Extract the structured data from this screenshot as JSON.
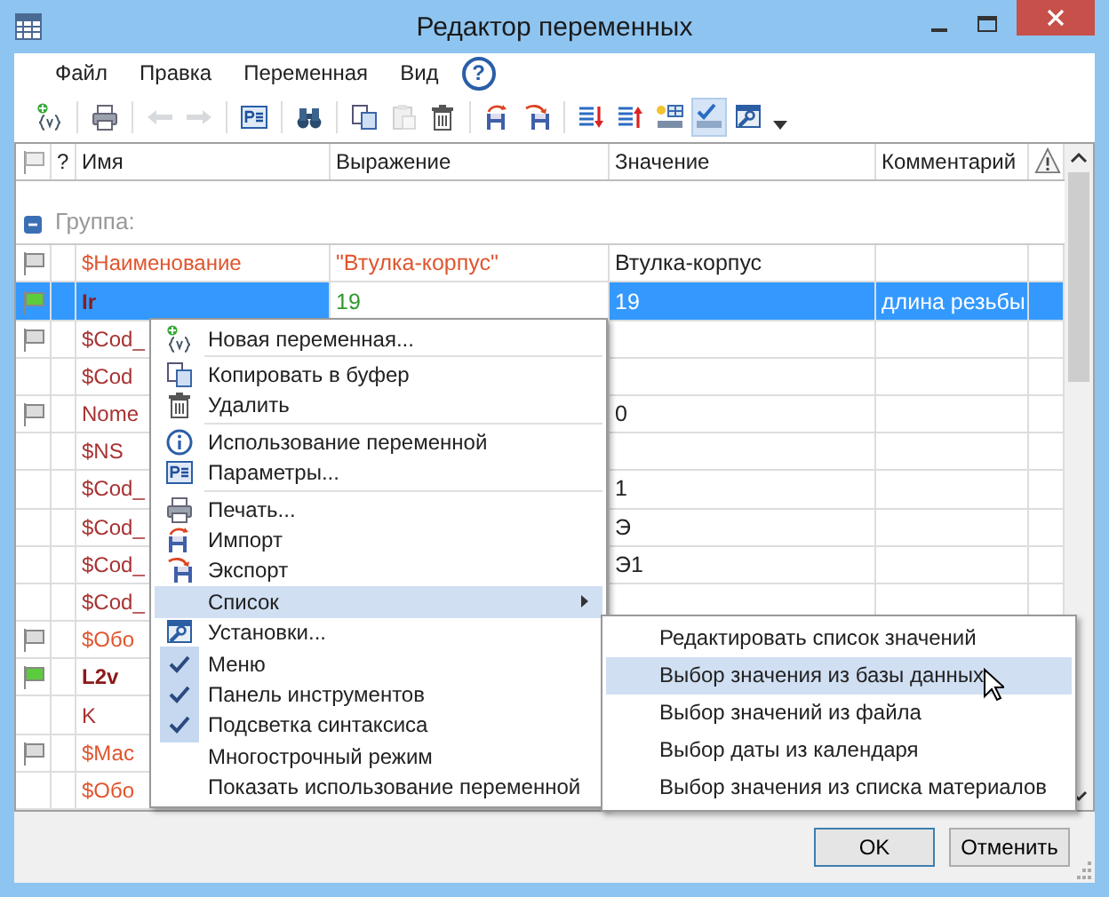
{
  "window": {
    "title": "Редактор переменных"
  },
  "menu": [
    {
      "label": "Файл"
    },
    {
      "label": "Правка"
    },
    {
      "label": "Переменная"
    },
    {
      "label": "Вид"
    }
  ],
  "help_button": {
    "label": "?"
  },
  "toolbar": [
    {
      "kind": "new",
      "disabled": false,
      "pressed": false
    },
    {
      "kind": "separator"
    },
    {
      "kind": "print",
      "disabled": false,
      "pressed": false
    },
    {
      "kind": "separator"
    },
    {
      "kind": "undo",
      "disabled": true,
      "pressed": false
    },
    {
      "kind": "redo",
      "disabled": true,
      "pressed": false
    },
    {
      "kind": "separator"
    },
    {
      "kind": "params",
      "disabled": false,
      "pressed": false
    },
    {
      "kind": "separator"
    },
    {
      "kind": "find",
      "disabled": false,
      "pressed": false
    },
    {
      "kind": "separator"
    },
    {
      "kind": "copy",
      "disabled": false,
      "pressed": false
    },
    {
      "kind": "paste",
      "disabled": true,
      "pressed": false
    },
    {
      "kind": "delete",
      "disabled": false,
      "pressed": false
    },
    {
      "kind": "separator"
    },
    {
      "kind": "import",
      "disabled": false,
      "pressed": false
    },
    {
      "kind": "export",
      "disabled": false,
      "pressed": false
    },
    {
      "kind": "separator"
    },
    {
      "kind": "sortdown",
      "disabled": false,
      "pressed": false
    },
    {
      "kind": "sortup",
      "disabled": false,
      "pressed": false
    },
    {
      "kind": "varnew",
      "disabled": false,
      "pressed": false
    },
    {
      "kind": "varcheck",
      "disabled": false,
      "pressed": true
    },
    {
      "kind": "settings",
      "disabled": false,
      "pressed": false
    }
  ],
  "table": {
    "columns": [
      "?",
      "Имя",
      "Выражение",
      "Значение",
      "Комментарий"
    ],
    "group": {
      "label": "Группа:",
      "expanded": true
    },
    "rows": [
      {
        "flag": {
          "color": "#dcdcdc"
        },
        "name": "$Наименование",
        "color": "#e0552e",
        "bold": false,
        "expression": {
          "text": "\"Втулка-корпус\"",
          "color": "#e0552e"
        },
        "value": "Втулка-корпус",
        "selected": false
      },
      {
        "flag": {
          "color": "#5ccc3c"
        },
        "name": "Ir",
        "color": "#8b1a1a",
        "bold": true,
        "expression": {
          "text": "19",
          "color": "#2f9a2f"
        },
        "value": "19",
        "comment": "длина резьбы",
        "selected": true
      },
      {
        "flag": {
          "color": "#dcdcdc"
        },
        "name": "$Cod_",
        "color": "#a83232",
        "bold": false,
        "selected": false
      },
      {
        "name": "$Cod",
        "color": "#a83232",
        "bold": false,
        "selected": false
      },
      {
        "flag": {
          "color": "#dcdcdc"
        },
        "name": "Nome",
        "color": "#a83232",
        "bold": false,
        "value": "0",
        "selected": false
      },
      {
        "name": "$NS",
        "color": "#a83232",
        "bold": false,
        "selected": false
      },
      {
        "name": "$Cod_",
        "color": "#a83232",
        "bold": false,
        "value": "1",
        "selected": false
      },
      {
        "name": "$Cod_",
        "color": "#a83232",
        "bold": false,
        "value": "Э",
        "selected": false
      },
      {
        "name": "$Cod_",
        "color": "#a83232",
        "bold": false,
        "value": "Э1",
        "selected": false
      },
      {
        "name": "$Cod_",
        "color": "#a83232",
        "bold": false,
        "selected": false
      },
      {
        "flag": {
          "color": "#dcdcdc"
        },
        "name": "$Обо",
        "color": "#e0552e",
        "bold": false,
        "selected": false
      },
      {
        "flag": {
          "color": "#5ccc3c"
        },
        "name": "L2v",
        "color": "#8b1a1a",
        "bold": true,
        "selected": false
      },
      {
        "name": "K",
        "color": "#a83232",
        "bold": false,
        "selected": false
      },
      {
        "flag": {
          "color": "#dcdcdc"
        },
        "name": "$Мас",
        "color": "#e0552e",
        "bold": false,
        "selected": false
      },
      {
        "name": "$Обо",
        "color": "#e0552e",
        "bold": false,
        "selected": false
      }
    ]
  },
  "buttons": [
    {
      "label": "OK"
    },
    {
      "label": "Отменить"
    }
  ],
  "context_menu": [
    {
      "label": "Новая переменная...",
      "kind": "new",
      "selected": false
    },
    {
      "kind": "separator"
    },
    {
      "label": "Копировать в буфер",
      "kind": "copy",
      "selected": false
    },
    {
      "label": "Удалить",
      "kind": "delete",
      "selected": false
    },
    {
      "kind": "separator"
    },
    {
      "label": "Использование переменной",
      "kind": "info",
      "selected": false
    },
    {
      "label": "Параметры...",
      "kind": "params",
      "selected": false
    },
    {
      "kind": "separator"
    },
    {
      "label": "Печать...",
      "kind": "print",
      "selected": false
    },
    {
      "label": "Импорт",
      "kind": "import",
      "selected": false
    },
    {
      "label": "Экспорт",
      "kind": "export",
      "selected": false
    },
    {
      "label": "Список",
      "kind": "submenu",
      "selected": true
    },
    {
      "label": "Установки...",
      "kind": "settings",
      "selected": false
    },
    {
      "label": "Меню",
      "kind": "check",
      "checked": true,
      "selected": false
    },
    {
      "label": "Панель инструментов",
      "kind": "check",
      "checked": true,
      "selected": false
    },
    {
      "label": "Подсветка синтаксиса",
      "kind": "check",
      "checked": true,
      "selected": false
    },
    {
      "label": "Многострочный режим",
      "kind": "check",
      "checked": false,
      "selected": false
    },
    {
      "label": "Показать использование переменной",
      "kind": "check",
      "checked": false,
      "selected": false
    }
  ],
  "submenu": [
    {
      "label": "Редактировать список значений",
      "selected": false
    },
    {
      "label": "Выбор значения из базы данных",
      "selected": true
    },
    {
      "label": "Выбор значений из файла",
      "selected": false
    },
    {
      "label": "Выбор даты из календаря",
      "selected": false
    },
    {
      "label": "Выбор значения из списка материалов",
      "selected": false
    }
  ]
}
